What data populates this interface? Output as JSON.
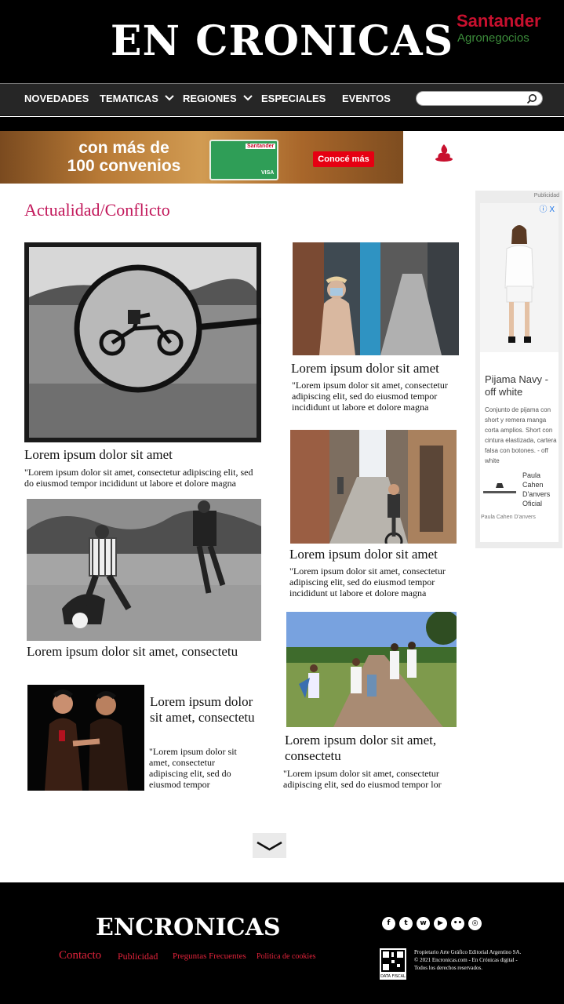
{
  "header": {
    "logo": "EN CRONICAS"
  },
  "nav": {
    "items": [
      "NOVEDADES",
      "TEMATICAS",
      "REGIONES",
      "ESPECIALES",
      "EVENTOS"
    ],
    "search_placeholder": ""
  },
  "banner": {
    "copy_line1": "con más de",
    "copy_line2": "100 convenios",
    "card_brand": "Santander",
    "card_network": "VISA",
    "cta": "Conocé más",
    "brand_name": "Santander",
    "brand_sub": "Agronegocios"
  },
  "section": {
    "title": "Actualidad/Conflicto"
  },
  "articles": [
    {
      "title": "Lorem ipsum dolor sit amet",
      "excerpt": "\"Lorem ipsum dolor sit amet, consectetur adipiscing elit, sed do eiusmod tempor incididunt ut labore et dolore magna"
    },
    {
      "title": "Lorem ipsum dolor sit amet, consectetu",
      "excerpt": ""
    },
    {
      "title": "Lorem ipsum dolor sit amet, consectetu",
      "excerpt": "\"Lorem ipsum dolor sit amet, consectetur adipiscing elit, sed do eiusmod tempor"
    },
    {
      "title": "Lorem ipsum dolor sit amet",
      "excerpt": "\"Lorem ipsum dolor sit amet, consectetur adipiscing elit, sed do eiusmod tempor incididunt ut labore et dolore magna"
    },
    {
      "title": "Lorem ipsum dolor sit amet",
      "excerpt": "\"Lorem ipsum dolor sit amet, consectetur adipiscing elit, sed do eiusmod tempor incididunt ut labore et dolore magna"
    },
    {
      "title": "Lorem ipsum dolor sit amet, consectetu",
      "excerpt": "\"Lorem ipsum dolor sit amet, consectetur adipiscing elit, sed do eiusmod tempor lor"
    }
  ],
  "ad": {
    "label": "Publicidad",
    "close": "ⓘ X",
    "product": "Pijama Navy - off white",
    "description": "Conjunto de pijama con short y remera manga corta amplios. Short con cintura elastizada, cartera falsa con botones. - off white",
    "brand": "Paula Cahen D'anvers Oficial",
    "footer": "Paula Cahen D'anvers"
  },
  "footer": {
    "logo": "ENCRONICAS",
    "links": [
      "Contacto",
      "Publicidad",
      "Preguntas Frecuentes",
      "Politica de cookies"
    ],
    "fiscal_text": "Propietario Arte Gráfico Editorial Argentino SA. © 2021 Encronicas.com - En Crónicas digital - Todos los derechos reservados.",
    "qr_label": "DATA FISCAL"
  },
  "colors": {
    "accent": "#c2185b",
    "footer_link": "#e2233b",
    "santander_red": "#e60012"
  }
}
